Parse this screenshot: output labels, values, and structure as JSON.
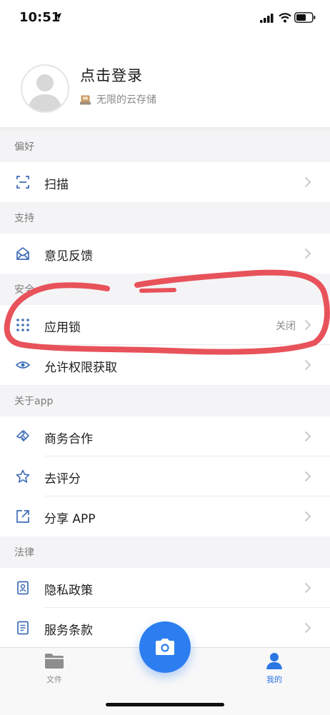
{
  "status_bar": {
    "time": "10:51"
  },
  "profile": {
    "title": "点击登录",
    "subtitle": "无限的云存储"
  },
  "sections": {
    "preferences": {
      "header": "偏好",
      "items": [
        {
          "label": "扫描"
        }
      ]
    },
    "support": {
      "header": "支持",
      "items": [
        {
          "label": "意见反馈"
        }
      ]
    },
    "security": {
      "header": "安全",
      "items": [
        {
          "label": "应用锁",
          "value": "关闭"
        },
        {
          "label": "允许权限获取"
        }
      ]
    },
    "about": {
      "header": "关于app",
      "items": [
        {
          "label": "商务合作"
        },
        {
          "label": "去评分"
        },
        {
          "label": "分享 APP"
        }
      ]
    },
    "legal": {
      "header": "法律",
      "items": [
        {
          "label": "隐私政策"
        },
        {
          "label": "服务条款"
        }
      ]
    }
  },
  "tabbar": {
    "files_label": "文件",
    "me_label": "我的"
  },
  "colors": {
    "accent": "#2c7ef0",
    "icon": "#3f6db8",
    "annotation": "#e8525a"
  }
}
